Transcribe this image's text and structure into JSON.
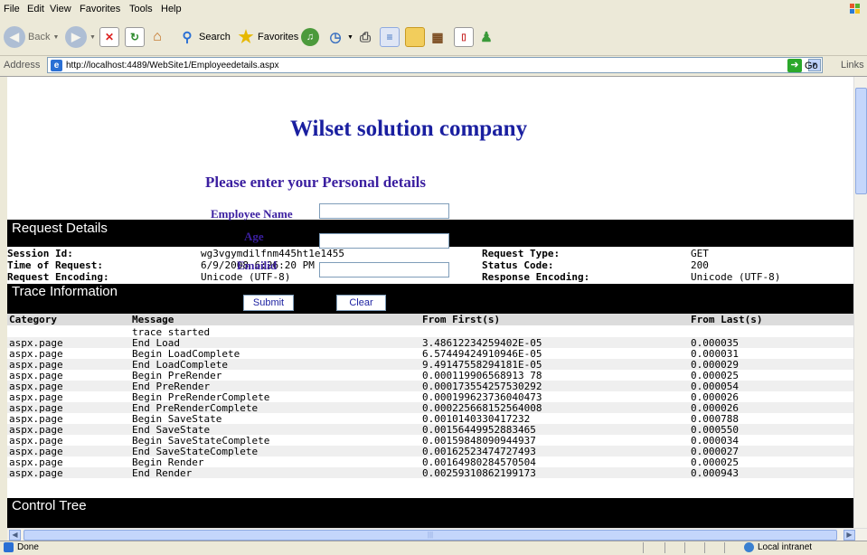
{
  "menu": [
    "File",
    "Edit",
    "View",
    "Favorites",
    "Tools",
    "Help"
  ],
  "toolbar": {
    "back": "Back",
    "search": "Search",
    "favorites": "Favorites"
  },
  "address": {
    "label": "Address",
    "url": "http://localhost:4489/WebSite1/Employeedetails.aspx",
    "go": "Go",
    "links": "Links"
  },
  "page": {
    "title": "Wilset solution company",
    "subtitle": "Please enter your Personal details",
    "fields": {
      "employee_name": "Employee Name",
      "age": "Age",
      "emailid": "Emailid"
    },
    "submit": "Submit",
    "clear": "Clear"
  },
  "request": {
    "header": "Request Details",
    "session_label": "Session Id:",
    "session_value": "wg3vgymdilfnm445ht1e1455",
    "time_label": "Time of Request:",
    "time_value": "6/9/2008 6:26:20 PM",
    "encoding_label": "Request Encoding:",
    "encoding_value": "Unicode (UTF-8)",
    "type_label": "Request Type:",
    "type_value": "GET",
    "status_label": "Status Code:",
    "status_value": "200",
    "resp_label": "Response Encoding:",
    "resp_value": "Unicode (UTF-8)"
  },
  "trace": {
    "header": "Trace Information",
    "columns": [
      "Category",
      "Message",
      "From First(s)",
      "From Last(s)"
    ],
    "rows": [
      [
        "",
        "trace started",
        "",
        ""
      ],
      [
        "aspx.page",
        "End Load",
        "3.48612234259402E-05",
        "0.000035"
      ],
      [
        "aspx.page",
        "Begin LoadComplete",
        "6.57449424910946E-05",
        "0.000031"
      ],
      [
        "aspx.page",
        "End LoadComplete",
        "9.49147558294181E-05",
        "0.000029"
      ],
      [
        "aspx.page",
        "Begin PreRender",
        "0.000119906568913 78",
        "0.000025"
      ],
      [
        "aspx.page",
        "End PreRender",
        "0.000173554257530292",
        "0.000054"
      ],
      [
        "aspx.page",
        "Begin PreRenderComplete",
        "0.000199623736040473",
        "0.000026"
      ],
      [
        "aspx.page",
        "End PreRenderComplete",
        "0.000225668152564008",
        "0.000026"
      ],
      [
        "aspx.page",
        "Begin SaveState",
        "0.0010140330417232",
        "0.000788"
      ],
      [
        "aspx.page",
        "End SaveState",
        "0.00156449952883465",
        "0.000550"
      ],
      [
        "aspx.page",
        "Begin SaveStateComplete",
        "0.00159848090944937",
        "0.000034"
      ],
      [
        "aspx.page",
        "End SaveStateComplete",
        "0.00162523474727493",
        "0.000027"
      ],
      [
        "aspx.page",
        "Begin Render",
        "0.00164980284570504",
        "0.000025"
      ],
      [
        "aspx.page",
        "End Render",
        "0.00259310862199173",
        "0.000943"
      ]
    ]
  },
  "control_tree": "Control Tree",
  "status": {
    "done": "Done",
    "zone": "Local intranet"
  }
}
